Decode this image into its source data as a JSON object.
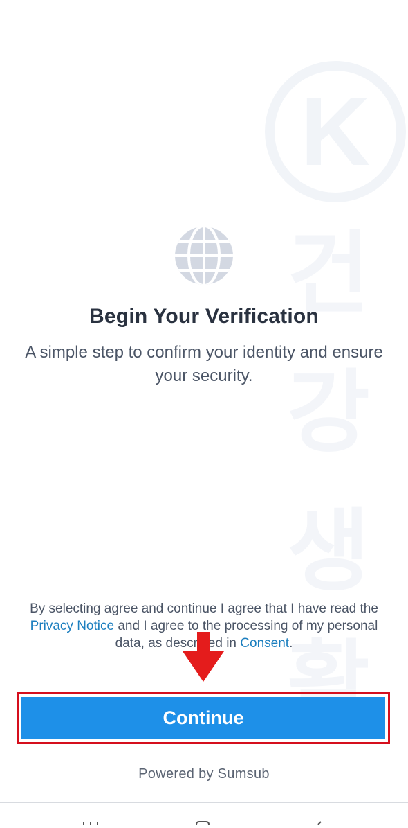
{
  "content": {
    "title": "Begin Your Verification",
    "subtitle": "A simple step to confirm your identity and ensure your security."
  },
  "consent": {
    "part1": "By selecting agree and continue I agree that I have read the ",
    "privacy_link": "Privacy Notice",
    "part2": " and I agree to the processing of my personal data, as described in ",
    "consent_link": "Consent",
    "part3": "."
  },
  "actions": {
    "continue_label": "Continue"
  },
  "footer": {
    "powered_by": "Powered by Sumsub"
  },
  "icons": {
    "globe": "globe-icon",
    "annotation_arrow": "arrow-down-icon"
  },
  "colors": {
    "primary": "#1e90e8",
    "link": "#1c7fbf",
    "annotation": "#d50f1d",
    "title": "#2a3240"
  },
  "watermark": {
    "letter": "K",
    "chars": [
      "건",
      "강",
      "생",
      "활"
    ]
  }
}
